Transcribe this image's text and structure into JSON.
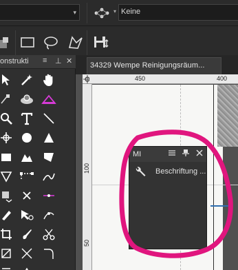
{
  "top_bar": {
    "mode_value": "Keine"
  },
  "tools_panel": {
    "title": "onstrukti",
    "menu_icon": "≡",
    "pin_icon": "⊥",
    "close_icon": "✕"
  },
  "document": {
    "tab_title": "34329 Wempe Reinigungsräum...",
    "tab_close": "✕"
  },
  "rulers": {
    "top_labels": [
      "450",
      "400"
    ],
    "left_labels": [
      "100",
      "50"
    ]
  },
  "mi_panel": {
    "title": "MI",
    "item_label": "Beschriftung ...",
    "icons": [
      "menu-icon",
      "pin-icon",
      "close-icon",
      "wrench-icon"
    ]
  },
  "colors": {
    "annotation": "#e0167e",
    "panel_bg": "#333333",
    "toolbar_bg": "#2b2b2b"
  }
}
